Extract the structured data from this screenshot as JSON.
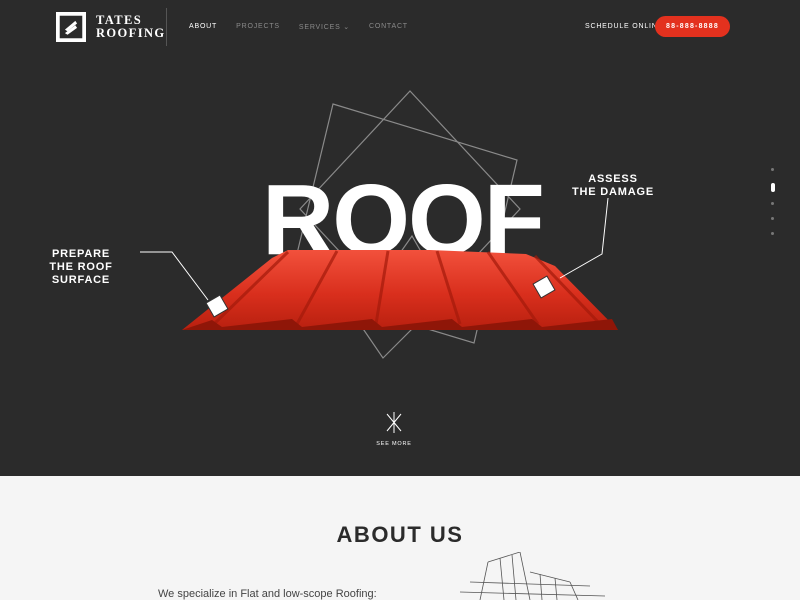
{
  "brand": {
    "name_line1": "TATES",
    "name_line2": "ROOFING"
  },
  "nav": {
    "items": [
      {
        "label": "ABOUT",
        "active": true
      },
      {
        "label": "PROJECTS",
        "active": false
      },
      {
        "label": "SERVICES ⌄",
        "active": false
      },
      {
        "label": "CONTACT",
        "active": false
      }
    ]
  },
  "header": {
    "schedule_label": "SCHEDULE ONLINE",
    "phone_label": "88-888-8888"
  },
  "hero": {
    "headline": "ROOF",
    "callouts": {
      "left": {
        "line1": "PREPARE",
        "line2": "THE ROOF SURFACE"
      },
      "right": {
        "line1": "ASSESS",
        "line2": "THE DAMAGE"
      }
    },
    "see_more": "SEE MORE"
  },
  "colors": {
    "accent": "#e3311e",
    "background": "#2b2b2b",
    "light_section": "#f5f5f5"
  },
  "about": {
    "title": "ABOUT US",
    "text": "We specialize in Flat and low-scope Roofing:"
  }
}
